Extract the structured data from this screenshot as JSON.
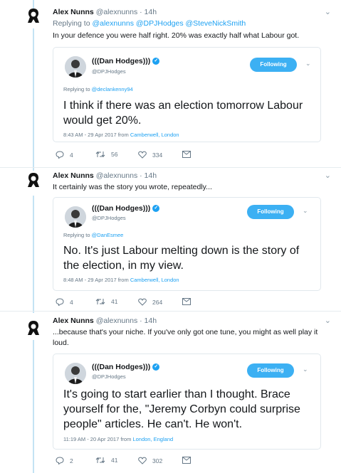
{
  "colors": {
    "accent": "#1da1f2",
    "follow_button": "#3cb0f3",
    "thread_line": "#c4e3f4",
    "muted": "#657786"
  },
  "tweets": [
    {
      "author_name": "Alex Nunns",
      "author_handle": "@alexnunns",
      "age": "· 14h",
      "replying_prefix": "Replying to",
      "replying_mentions": "@alexnunns @DPJHodges @SteveNickSmith",
      "text": "In your defence you were half right. 20% was exactly half what Labour got.",
      "quote": {
        "name": "(((Dan Hodges)))",
        "handle": "@DPJHodges",
        "follow_label": "Following",
        "replying_prefix": "Replying to",
        "replying_mention": "@declankenny94",
        "text": "I think if there was an election tomorrow Labour would get 20%.",
        "meta_prefix": "8:43 AM - 29 Apr 2017 from",
        "location": "Camberwell, London"
      },
      "replies": "4",
      "retweets": "56",
      "likes": "334"
    },
    {
      "author_name": "Alex Nunns",
      "author_handle": "@alexnunns",
      "age": "· 14h",
      "text": "It certainly was the story you wrote, repeatedly...",
      "quote": {
        "name": "(((Dan Hodges)))",
        "handle": "@DPJHodges",
        "follow_label": "Following",
        "replying_prefix": "Replying to",
        "replying_mention": "@DanEsmee",
        "text": "No. It's just Labour melting down is the story of the election, in my view.",
        "meta_prefix": "8:48 AM - 29 Apr 2017 from",
        "location": "Camberwell, London"
      },
      "replies": "4",
      "retweets": "41",
      "likes": "264"
    },
    {
      "author_name": "Alex Nunns",
      "author_handle": "@alexnunns",
      "age": "· 14h",
      "text": "...because that's your niche. If you've only got one tune, you might as well play it loud.",
      "quote": {
        "name": "(((Dan Hodges)))",
        "handle": "@DPJHodges",
        "follow_label": "Following",
        "text": "It's going to start earlier than I thought. Brace yourself for the, \"Jeremy Corbyn could surprise people\" articles. He can't. He won't.",
        "meta_prefix": "11:19 AM - 20 Apr 2017 from",
        "location": "London, England"
      },
      "replies": "2",
      "retweets": "41",
      "likes": "302"
    }
  ]
}
